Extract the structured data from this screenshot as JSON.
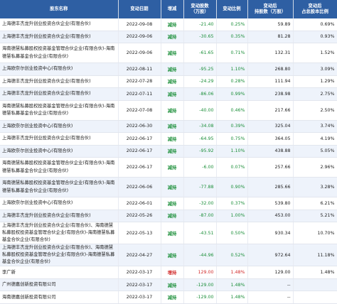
{
  "colors": {
    "header_bg": "#2e5fa3",
    "decrease": "#1c8f3a",
    "increase": "#d12a2a",
    "row_alt": "#eef3fb"
  },
  "headers": {
    "holder": "股东名称",
    "date": "变动日期",
    "direction": "增减",
    "change_shares": "变动股数\n（万股）",
    "change_ratio": "变动比例",
    "after_shares": "变动后\n持股数（万股）",
    "after_ratio": "变动后\n占总股本比例"
  },
  "rows": [
    {
      "holder": "上海德丰杰龙升创业投资合伙企业(有限合伙)",
      "date": "2022-09-08",
      "direction": "减持",
      "change_shares": "-21.40",
      "change_ratio": "0.25%",
      "after_shares": "59.89",
      "after_ratio": "0.69%",
      "type": "dec"
    },
    {
      "holder": "上海德丰杰龙升创业投资合伙企业(有限合伙)",
      "date": "2022-09-06",
      "direction": "减持",
      "change_shares": "-30.65",
      "change_ratio": "0.35%",
      "after_shares": "81.28",
      "after_ratio": "0.93%",
      "type": "dec"
    },
    {
      "holder": "海南德慧私募股权投资基金管理合伙企业(有限合伙)-海南德慧私募基金合伙企业(有限合伙)",
      "date": "2022-09-06",
      "direction": "减持",
      "change_shares": "-61.65",
      "change_ratio": "0.71%",
      "after_shares": "132.31",
      "after_ratio": "1.52%",
      "type": "dec"
    },
    {
      "holder": "上海欧奈尔创业投资中心(有限合伙)",
      "date": "2022-08-11",
      "direction": "减持",
      "change_shares": "-95.25",
      "change_ratio": "1.10%",
      "after_shares": "268.80",
      "after_ratio": "3.09%",
      "type": "dec"
    },
    {
      "holder": "上海德丰杰龙升创业投资合伙企业(有限合伙)",
      "date": "2022-07-28",
      "direction": "减持",
      "change_shares": "-24.29",
      "change_ratio": "0.28%",
      "after_shares": "111.94",
      "after_ratio": "1.29%",
      "type": "dec"
    },
    {
      "holder": "上海德丰杰龙升创业投资合伙企业(有限合伙)",
      "date": "2022-07-11",
      "direction": "减持",
      "change_shares": "-86.06",
      "change_ratio": "0.99%",
      "after_shares": "238.98",
      "after_ratio": "2.75%",
      "type": "dec"
    },
    {
      "holder": "海南德慧私募股权投资基金管理合伙企业(有限合伙)-海南德慧私募基金合伙企业(有限合伙)",
      "date": "2022-07-08",
      "direction": "减持",
      "change_shares": "-40.00",
      "change_ratio": "0.46%",
      "after_shares": "217.66",
      "after_ratio": "2.50%",
      "type": "dec"
    },
    {
      "holder": "上海欧奈尔创业投资中心(有限合伙)",
      "date": "2022-06-30",
      "direction": "减持",
      "change_shares": "-34.08",
      "change_ratio": "0.39%",
      "after_shares": "325.04",
      "after_ratio": "3.74%",
      "type": "dec"
    },
    {
      "holder": "上海德丰杰龙升创业投资合伙企业(有限合伙)",
      "date": "2022-06-17",
      "direction": "减持",
      "change_shares": "-64.95",
      "change_ratio": "0.75%",
      "after_shares": "364.05",
      "after_ratio": "4.19%",
      "type": "dec"
    },
    {
      "holder": "上海欧奈尔创业投资中心(有限合伙)",
      "date": "2022-06-17",
      "direction": "减持",
      "change_shares": "-95.92",
      "change_ratio": "1.10%",
      "after_shares": "438.88",
      "after_ratio": "5.05%",
      "type": "dec"
    },
    {
      "holder": "海南德慧私募股权投资基金管理合伙企业(有限合伙)-海南德慧私募基金合伙企业(有限合伙)",
      "date": "2022-06-17",
      "direction": "减持",
      "change_shares": "-6.00",
      "change_ratio": "0.07%",
      "after_shares": "257.66",
      "after_ratio": "2.96%",
      "type": "dec"
    },
    {
      "holder": "海南德慧私募股权投资基金管理合伙企业(有限合伙)-海南德慧私募基金合伙企业(有限合伙)",
      "date": "2022-06-06",
      "direction": "减持",
      "change_shares": "-77.88",
      "change_ratio": "0.90%",
      "after_shares": "285.66",
      "after_ratio": "3.28%",
      "type": "dec"
    },
    {
      "holder": "上海欧奈尔创业投资中心(有限合伙)",
      "date": "2022-06-01",
      "direction": "减持",
      "change_shares": "-32.00",
      "change_ratio": "0.37%",
      "after_shares": "539.80",
      "after_ratio": "6.21%",
      "type": "dec"
    },
    {
      "holder": "上海德丰杰龙升创业投资合伙企业(有限合伙)",
      "date": "2022-05-26",
      "direction": "减持",
      "change_shares": "-87.00",
      "change_ratio": "1.00%",
      "after_shares": "453.00",
      "after_ratio": "5.21%",
      "type": "dec"
    },
    {
      "holder": "上海德丰杰龙升创业投资合伙企业(有限合伙)、海南德慧私募股权投资基金管理合伙企业(有限合伙)-海南德慧私募基金合伙企业(有限合伙)",
      "date": "2022-05-13",
      "direction": "减持",
      "change_shares": "-43.51",
      "change_ratio": "0.50%",
      "after_shares": "930.34",
      "after_ratio": "10.70%",
      "type": "dec"
    },
    {
      "holder": "上海德丰杰龙升创业投资合伙企业(有限合伙)、海南德慧私募股权投资基金管理合伙企业(有限合伙)-海南德慧私募基金合伙企业(有限合伙)",
      "date": "2022-04-27",
      "direction": "减持",
      "change_shares": "-44.96",
      "change_ratio": "0.52%",
      "after_shares": "972.64",
      "after_ratio": "11.18%",
      "type": "dec"
    },
    {
      "holder": "李广新",
      "date": "2022-03-17",
      "direction": "增持",
      "change_shares": "129.00",
      "change_ratio": "1.48%",
      "after_shares": "129.00",
      "after_ratio": "1.48%",
      "type": "inc"
    },
    {
      "holder": "广州德嘉创新投资有限公司",
      "date": "2022-03-17",
      "direction": "减持",
      "change_shares": "-129.00",
      "change_ratio": "1.48%",
      "after_shares": "--",
      "after_ratio": "",
      "type": "dec"
    },
    {
      "holder": "海南德嘉创新投资有限公司",
      "date": "2022-03-17",
      "direction": "减持",
      "change_shares": "-129.00",
      "change_ratio": "1.48%",
      "after_shares": "--",
      "after_ratio": "",
      "type": "dec"
    }
  ]
}
